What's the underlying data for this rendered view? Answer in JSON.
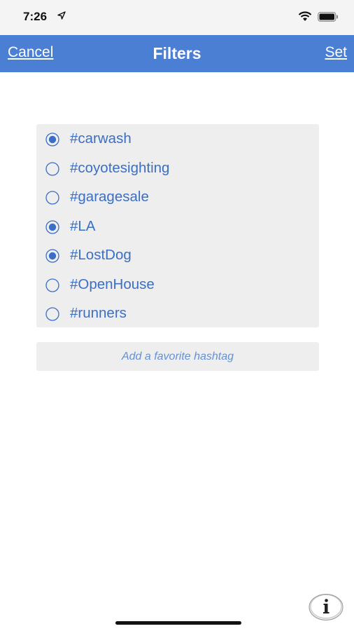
{
  "status_bar": {
    "time": "7:26",
    "icons": [
      "location-arrow-icon",
      "wifi-icon",
      "battery-icon"
    ]
  },
  "nav": {
    "cancel_label": "Cancel",
    "title": "Filters",
    "set_label": "Set"
  },
  "hashtags": [
    {
      "label": "#carwash",
      "selected": true
    },
    {
      "label": "#coyotesighting",
      "selected": false
    },
    {
      "label": "#garagesale",
      "selected": false
    },
    {
      "label": "#LA",
      "selected": true
    },
    {
      "label": "#LostDog",
      "selected": true
    },
    {
      "label": "#OpenHouse",
      "selected": false
    },
    {
      "label": "#runners",
      "selected": false
    }
  ],
  "add_hashtag": {
    "placeholder": "Add a favorite hashtag",
    "value": ""
  },
  "info_button": {
    "icon": "info-icon"
  },
  "colors": {
    "accent": "#4a7fd4",
    "text_blue": "#3a6fc4",
    "panel_bg": "#eeeeee"
  }
}
